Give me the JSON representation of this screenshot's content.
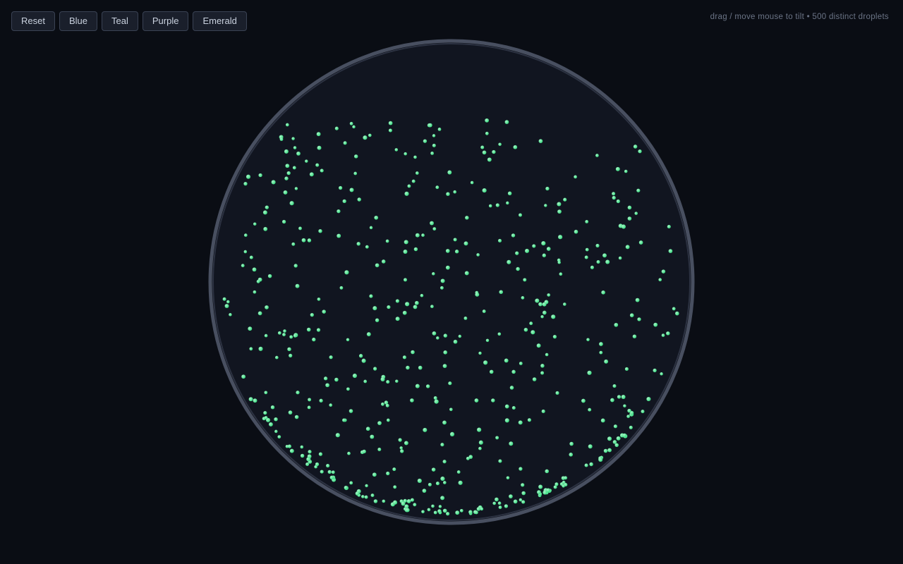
{
  "toolbar": {
    "buttons": [
      {
        "label": "Reset"
      },
      {
        "label": "Blue"
      },
      {
        "label": "Teal"
      },
      {
        "label": "Purple"
      },
      {
        "label": "Emerald"
      }
    ]
  },
  "hint": "drag / move mouse to tilt • 500 distinct droplets",
  "simulation": {
    "droplet_count": 500,
    "active_palette": "Emerald",
    "droplet_color": "#3ddc84",
    "droplet_highlight": "#aaf5c8",
    "dish_fill": "#111520",
    "dish_rim": "#5d6579",
    "background": "#0a0d14"
  }
}
